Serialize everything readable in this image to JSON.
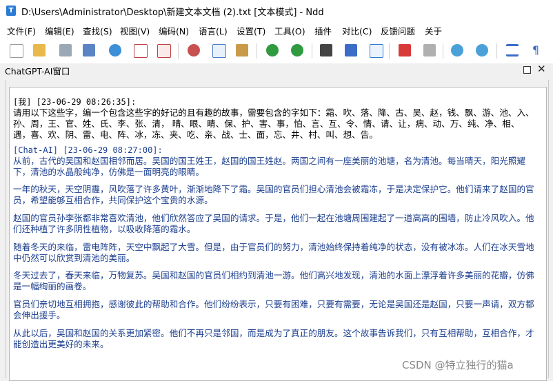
{
  "window": {
    "app_icon_letter": "T",
    "title": "D:\\Users\\Administrator\\Desktop\\新建文本文档 (2).txt [文本模式] - Ndd"
  },
  "menu": {
    "file": "文件(F)",
    "edit": "编辑(E)",
    "search": "查找(S)",
    "view": "视图(V)",
    "encoding": "编码(N)",
    "language": "语言(L)",
    "settings": "设置(T)",
    "tools": "工具(O)",
    "plugins": "插件",
    "compare": "对比(C)",
    "feedback": "反馈问题",
    "about": "关于"
  },
  "toolbar": {
    "icons": [
      "new-file-icon",
      "open-file-icon",
      "save-icon",
      "save-all-icon",
      "reload-icon",
      "close-icon",
      "close-all-icon",
      "cut-icon",
      "copy-icon",
      "paste-icon",
      "undo-icon",
      "redo-icon",
      "find-icon",
      "replace-icon",
      "bookmark-icon",
      "highlight-icon",
      "clear-highlight-icon",
      "zoom-in-icon",
      "zoom-out-icon",
      "word-wrap-icon",
      "show-symbols-icon"
    ]
  },
  "panel": {
    "title": "ChatGPT-AI窗口"
  },
  "chat": {
    "user_header": "[我] [23-06-29 08:26:35]:",
    "user_text": "请用以下这些字，编一个包含这些字的好记的且有趣的故事，需要包含的字如下：霜、吹、落、降、古、吴、赵，钱、飘、游、池、入、孙、周，王、官、姓、氏、李、张、清， 晴、眼、睛、保、护、害、事，怕、言、互、令、情、请、让，病、动、万、纯、净、相、遇，喜、欢、阴、雷、电、阵、冰，冻、夹、吃、亲、战、士、面，忘、井、村、叫、想、告。",
    "ai_header": "[Chat-AI] [23-06-29 08:27:00]:",
    "ai_paragraphs": [
      "从前，古代的吴国和赵国相邻而居。吴国的国王姓王，赵国的国王姓赵。两国之间有一座美丽的池塘，名为清池。每当晴天，阳光照耀下，清池的水晶般纯净，仿佛是一面明亮的眼睛。",
      "一年的秋天，天空阴霾，风吹落了许多黄叶，渐渐地降下了霜。吴国的官员们担心清池会被霜冻，于是决定保护它。他们请来了赵国的官员，希望能够互相合作，共同保护这个宝贵的水源。",
      "赵国的官员孙李张都非常喜欢清池，他们欣然答应了吴国的请求。于是，他们一起在池塘周围建起了一道高高的围墙，防止冷风吹入。他们还种植了许多阴性植物，以吸收降落的霜水。",
      "随着冬天的来临，雷电阵阵，天空中飘起了大雪。但是，由于官员们的努力，清池始终保持着纯净的状态，没有被冰冻。人们在冰天雪地中仍然可以欣赏到清池的美丽。",
      "冬天过去了，春天来临，万物复苏。吴国和赵国的官员们相约到清池一游。他们高兴地发现，清池的水面上漂浮着许多美丽的花瓣，仿佛是一幅绚丽的画卷。",
      "官员们亲切地互相拥抱，感谢彼此的帮助和合作。他们纷纷表示，只要有困难，只要有需要，无论是吴国还是赵国，只要一声请，双方都会伸出援手。",
      "从此以后，吴国和赵国的关系更加紧密。他们不再只是邻国，而是成为了真正的朋友。这个故事告诉我们，只有互相帮助，互相合作，才能创造出更美好的未来。"
    ]
  },
  "watermark": "CSDN @特立独行的猫a",
  "colors": {
    "ai_text": "#1c3f8f",
    "user_text": "#000000",
    "app_icon": "#2a7bd4"
  }
}
